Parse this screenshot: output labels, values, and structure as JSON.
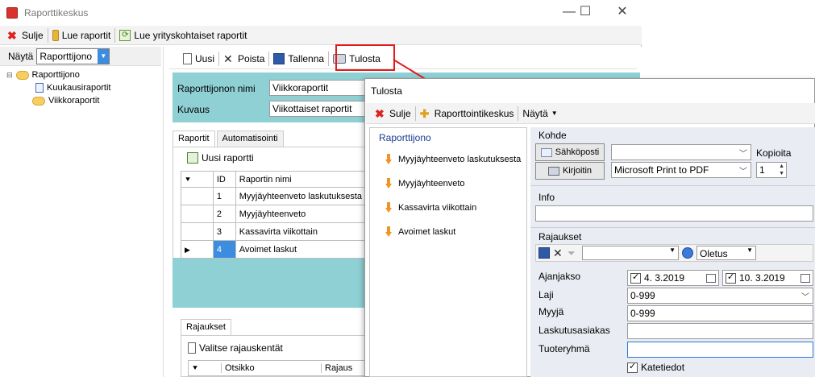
{
  "window": {
    "title": "Raporttikeskus",
    "controls": {
      "minimize": "—",
      "maximize": "☐",
      "close": "✕"
    }
  },
  "toolbar1": {
    "close_label": "Sulje",
    "read_reports_label": "Lue raportit",
    "read_company_reports_label": "Lue yrityskohtaiset raportit"
  },
  "leftpane": {
    "show_label": "Näytä",
    "show_value": "Raporttijono",
    "tree": {
      "root": "Raporttijono",
      "children": [
        "Kuukausiraportit",
        "Viikkoraportit"
      ]
    }
  },
  "toolbar2": {
    "new_label": "Uusi",
    "delete_label": "Poista",
    "save_label": "Tallenna",
    "print_label": "Tulosta"
  },
  "queue_form": {
    "name_label": "Raporttijonon nimi",
    "name_value": "Viikkoraportit",
    "desc_label": "Kuvaus",
    "desc_value": "Viikottaiset raportit"
  },
  "tabs": [
    "Raportit",
    "Automatisointi"
  ],
  "reports_grid": {
    "new_report_label": "Uusi raportti",
    "columns": [
      "ID",
      "Raportin nimi"
    ],
    "rows": [
      {
        "id": "1",
        "name": "Myyjäyhteenveto laskutuksesta"
      },
      {
        "id": "2",
        "name": "Myyjäyhteenveto"
      },
      {
        "id": "3",
        "name": "Kassavirta viikottain"
      },
      {
        "id": "4",
        "name": "Avoimet laskut"
      }
    ]
  },
  "restrictions_panel": {
    "tab": "Rajaukset",
    "select_fields_label": "Valitse rajauskentät",
    "columns": [
      "Otsikko",
      "Rajaus"
    ]
  },
  "dialog": {
    "title": "Tulosta",
    "toolbar": {
      "close_label": "Sulje",
      "center_label": "Raporttointikeskus",
      "show_label": "Näytä"
    },
    "queue_heading": "Raporttijono",
    "queue_items": [
      "Myyjäyhteenveto laskutuksesta",
      "Myyjäyhteenveto",
      "Kassavirta viikottain",
      "Avoimet laskut"
    ],
    "target": {
      "heading": "Kohde",
      "email_label": "Sähköposti",
      "printer_label": "Kirjoitin",
      "email_value": "",
      "printer_value": "Microsoft Print to PDF",
      "copies_label": "Kopioita",
      "copies_value": "1"
    },
    "info": {
      "heading": "Info",
      "value": ""
    },
    "restrictions": {
      "heading": "Rajaukset",
      "preset_value": "Oletus",
      "filter_value": "",
      "period_label": "Ajanjakso",
      "date_from": "4.  3.2019",
      "date_to": "10.  3.2019",
      "type_label": "Laji",
      "type_value": "0-999",
      "seller_label": "Myyjä",
      "seller_value": "0-999",
      "customer_label": "Laskutusasiakas",
      "customer_value": "",
      "product_group_label": "Tuoteryhmä",
      "product_group_value": "",
      "margin_label": "Katetiedot"
    }
  }
}
